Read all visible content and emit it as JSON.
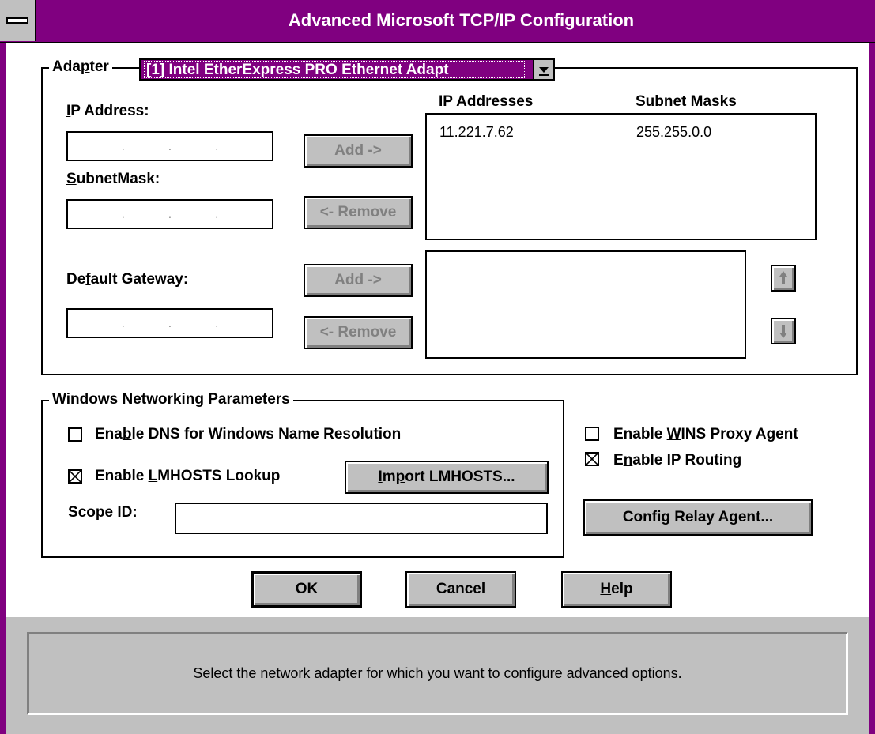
{
  "window": {
    "title": "Advanced Microsoft TCP/IP Configuration"
  },
  "adapter": {
    "label": "Adapter",
    "selected": "[1] Intel EtherExpress PRO Ethernet Adapt"
  },
  "ip": {
    "address_label": "IP Address:",
    "subnet_label": "SubnetMask:",
    "add_label": "Add ->",
    "remove_label": "<- Remove",
    "list_headers": [
      "IP Addresses",
      "Subnet Masks"
    ],
    "rows": [
      {
        "ip": "11.221.7.62",
        "mask": "255.255.0.0"
      }
    ]
  },
  "gateway": {
    "label": "Default Gateway:",
    "add_label": "Add ->",
    "remove_label": "<- Remove"
  },
  "wnp": {
    "group_label": "Windows Networking Parameters",
    "dns_label": "Enable DNS for Windows Name Resolution",
    "dns_checked": false,
    "lmhosts_label": "Enable LMHOSTS Lookup",
    "lmhosts_checked": true,
    "import_label": "Import LMHOSTS...",
    "scope_label": "Scope ID:",
    "scope_value": ""
  },
  "right_options": {
    "wins_label": "Enable WINS Proxy Agent",
    "wins_checked": false,
    "routing_label": "Enable IP Routing",
    "routing_checked": true,
    "relay_label": "Config Relay Agent..."
  },
  "footer": {
    "ok": "OK",
    "cancel": "Cancel",
    "help": "Help"
  },
  "status": {
    "text": "Select the network adapter for which you want to configure advanced options."
  },
  "colors": {
    "titlebar": "#800080",
    "face": "#c0c0c0",
    "selection": "#800080"
  }
}
